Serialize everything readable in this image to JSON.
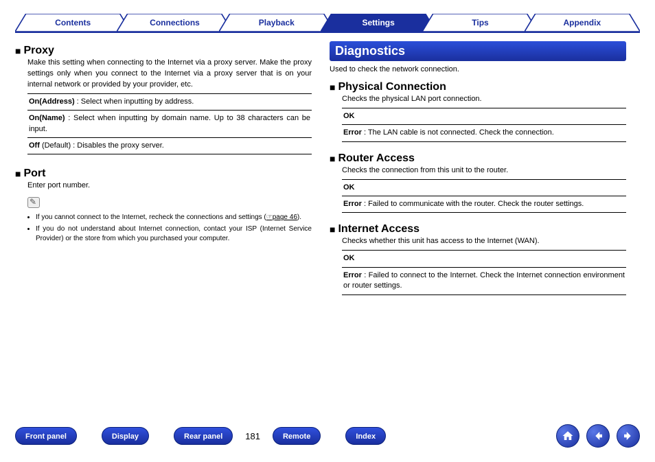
{
  "tabs": {
    "contents": "Contents",
    "connections": "Connections",
    "playback": "Playback",
    "settings": "Settings",
    "tips": "Tips",
    "appendix": "Appendix"
  },
  "left": {
    "proxy": {
      "title": "Proxy",
      "desc": "Make this setting when connecting to the Internet via a proxy server. Make the proxy settings only when you connect to the Internet via a proxy server that is on your internal network or provided by your provider, etc.",
      "row1_label": "On(Address)",
      "row1_text": " : Select when inputting by address.",
      "row2_label": "On(Name)",
      "row2_text": " : Select when inputting by domain name. Up to 38 characters can be input.",
      "row3_label": "Off",
      "row3_text": " (Default) : Disables the proxy server."
    },
    "port": {
      "title": "Port",
      "desc": "Enter port number.",
      "bullet1a": "If you cannot connect to the Internet, recheck the connections and settings (",
      "bullet1_link": "☞page 46",
      "bullet1b": ").",
      "bullet2": "If you do not understand about Internet connection, contact your ISP (Internet Service Provider) or the store from which you purchased your computer."
    }
  },
  "right": {
    "header": "Diagnostics",
    "intro": "Used to check the network connection.",
    "phys": {
      "title": "Physical Connection",
      "desc": "Checks the physical LAN port connection.",
      "row1": "OK",
      "row2_label": "Error",
      "row2_text": " : The LAN cable is not connected. Check the connection."
    },
    "router": {
      "title": "Router Access",
      "desc": "Checks the connection from this unit to the router.",
      "row1": "OK",
      "row2_label": "Error",
      "row2_text": " : Failed to communicate with the router. Check the router settings."
    },
    "inet": {
      "title": "Internet Access",
      "desc": "Checks whether this unit has access to the Internet (WAN).",
      "row1": "OK",
      "row2_label": "Error",
      "row2_text": " : Failed to connect to the Internet. Check the Internet connection environment or router settings."
    }
  },
  "bottom": {
    "front_panel": "Front panel",
    "display": "Display",
    "rear_panel": "Rear panel",
    "page": "181",
    "remote": "Remote",
    "index": "Index"
  }
}
